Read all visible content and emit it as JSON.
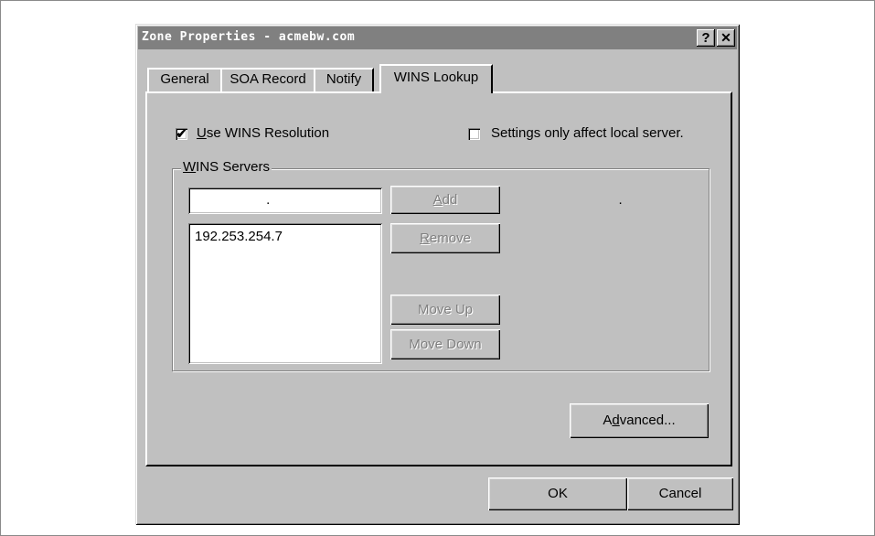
{
  "window": {
    "title": "Zone Properties - acmebw.com",
    "help_glyph": "?",
    "close_glyph": "✕"
  },
  "tabs": [
    {
      "label": "General"
    },
    {
      "label": "SOA Record"
    },
    {
      "label": "Notify"
    },
    {
      "label": "WINS Lookup",
      "active": true
    }
  ],
  "options": {
    "use_wins": {
      "label_pre": "",
      "label_u": "U",
      "label_post": "se WINS Resolution",
      "checked": true,
      "mark": "✔"
    },
    "local_only": {
      "label": "Settings only affect local server.",
      "checked": false,
      "mark": ""
    }
  },
  "wins_servers": {
    "group_label_u": "W",
    "group_label_post": "INS Servers",
    "ip_input_value": " .   .   . ",
    "servers": [
      "192.253.254.7"
    ],
    "buttons": {
      "add": {
        "u": "A",
        "post": "dd",
        "enabled": false
      },
      "remove": {
        "u": "R",
        "post": "emove",
        "enabled": false
      },
      "move_up": {
        "label": "Move Up",
        "enabled": false
      },
      "move_down": {
        "label": "Move Down",
        "enabled": false
      }
    }
  },
  "advanced": {
    "pre": "A",
    "u": "d",
    "post": "vanced..."
  },
  "footer": {
    "ok": "OK",
    "cancel": "Cancel"
  }
}
